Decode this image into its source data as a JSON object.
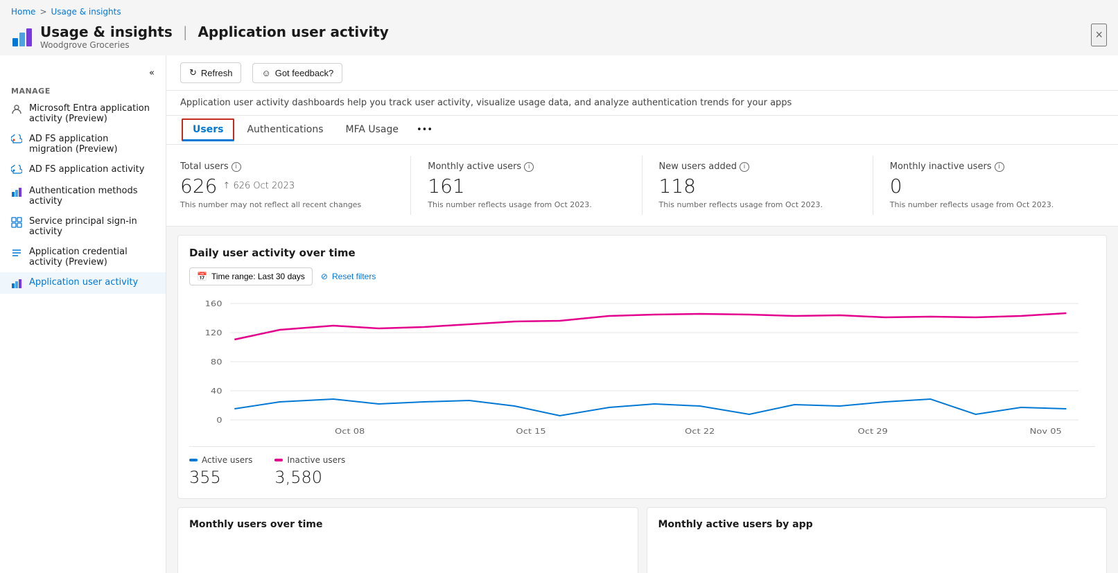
{
  "breadcrumb": {
    "home": "Home",
    "separator": ">",
    "current": "Usage & insights"
  },
  "page_header": {
    "title": "Usage & insights",
    "separator": "|",
    "subtitle_page": "Application user activity",
    "org_name": "Woodgrove Groceries",
    "close_label": "×"
  },
  "sidebar": {
    "collapse_label": "«",
    "manage_label": "Manage",
    "items": [
      {
        "id": "entra-app",
        "label": "Microsoft Entra application activity (Preview)",
        "icon": "person-icon"
      },
      {
        "id": "adfs-migration",
        "label": "AD FS application migration (Preview)",
        "icon": "cloud-icon"
      },
      {
        "id": "adfs-activity",
        "label": "AD FS application activity",
        "icon": "cloud-icon"
      },
      {
        "id": "auth-methods",
        "label": "Authentication methods activity",
        "icon": "chart-icon"
      },
      {
        "id": "service-principal",
        "label": "Service principal sign-in activity",
        "icon": "grid-icon"
      },
      {
        "id": "app-credential",
        "label": "Application credential activity (Preview)",
        "icon": "list-icon"
      },
      {
        "id": "app-user-activity",
        "label": "Application user activity",
        "icon": "chart-icon",
        "active": true
      }
    ]
  },
  "toolbar": {
    "refresh_label": "Refresh",
    "feedback_label": "Got feedback?"
  },
  "description": "Application user activity dashboards help you track user activity, visualize usage data, and analyze authentication trends for your apps",
  "tabs": [
    {
      "id": "users",
      "label": "Users",
      "active": true
    },
    {
      "id": "authentications",
      "label": "Authentications",
      "active": false
    },
    {
      "id": "mfa-usage",
      "label": "MFA Usage",
      "active": false
    }
  ],
  "stats": [
    {
      "id": "total-users",
      "label": "Total users",
      "value": "626",
      "trend": "↑ 626 Oct 2023",
      "note": "This number may not reflect all recent changes"
    },
    {
      "id": "monthly-active-users",
      "label": "Monthly active users",
      "value": "161",
      "trend": "",
      "note": "This number reflects usage from Oct 2023."
    },
    {
      "id": "new-users-added",
      "label": "New users added",
      "value": "118",
      "trend": "",
      "note": "This number reflects usage from Oct 2023."
    },
    {
      "id": "monthly-inactive-users",
      "label": "Monthly inactive users",
      "value": "0",
      "trend": "",
      "note": "This number reflects usage from Oct 2023."
    }
  ],
  "chart": {
    "title": "Daily user activity over time",
    "time_range_label": "Time range: Last 30 days",
    "reset_filters_label": "Reset filters",
    "x_labels": [
      "Oct 08",
      "Oct 15",
      "Oct 22",
      "Oct 29",
      "Nov 05"
    ],
    "y_labels": [
      "160",
      "120",
      "80",
      "40",
      "0"
    ],
    "active_line_color": "#0078d4",
    "inactive_line_color": "#e3008c",
    "legend": [
      {
        "id": "active-users",
        "label": "Active users",
        "color": "#0078d4",
        "value": "355"
      },
      {
        "id": "inactive-users",
        "label": "Inactive users",
        "color": "#e3008c",
        "value": "3,580"
      }
    ]
  },
  "bottom_charts": [
    {
      "id": "monthly-users-over-time",
      "title": "Monthly users over time"
    },
    {
      "id": "monthly-active-users-by-app",
      "title": "Monthly active users by app"
    }
  ]
}
